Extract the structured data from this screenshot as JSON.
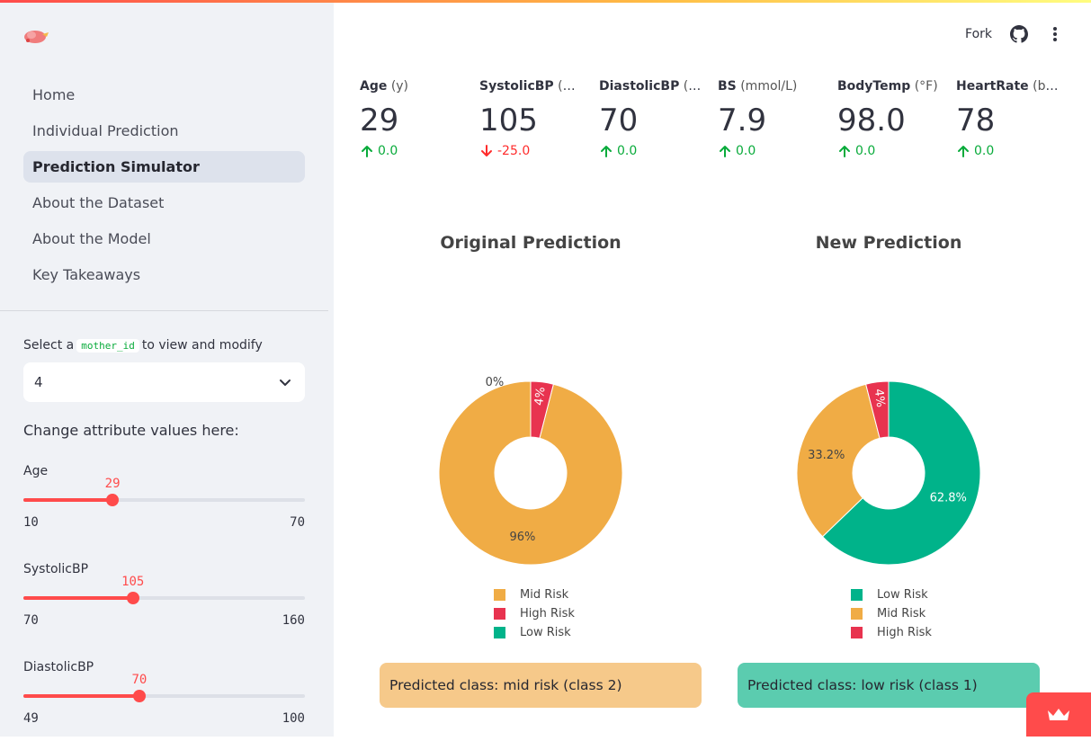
{
  "sidebar": {
    "nav": [
      {
        "label": "Home"
      },
      {
        "label": "Individual Prediction"
      },
      {
        "label": "Prediction Simulator",
        "active": true
      },
      {
        "label": "About the Dataset"
      },
      {
        "label": "About the Model"
      },
      {
        "label": "Key Takeaways"
      }
    ],
    "select": {
      "label_before": "Select a",
      "label_code": "mother_id",
      "label_after": "to view and modify",
      "value": "4"
    },
    "change_label": "Change attribute values here:",
    "sliders": [
      {
        "label": "Age",
        "value": 29,
        "min": 10,
        "max": 70
      },
      {
        "label": "SystolicBP",
        "value": 105,
        "min": 70,
        "max": 160
      },
      {
        "label": "DiastolicBP",
        "value": 70,
        "min": 49,
        "max": 100
      }
    ]
  },
  "header": {
    "fork_label": "Fork",
    "icons": [
      "github-icon",
      "kebab-menu-icon"
    ]
  },
  "metrics": [
    {
      "name": "Age",
      "unit": "(y)",
      "value": "29",
      "delta": "0.0",
      "direction": "up"
    },
    {
      "name": "SystolicBP",
      "unit": "(m…",
      "value": "105",
      "delta": "-25.0",
      "direction": "down"
    },
    {
      "name": "DiastolicBP",
      "unit": "(m…",
      "value": "70",
      "delta": "0.0",
      "direction": "up"
    },
    {
      "name": "BS",
      "unit": "(mmol/L)",
      "value": "7.9",
      "delta": "0.0",
      "direction": "up"
    },
    {
      "name": "BodyTemp",
      "unit": "(°F)",
      "value": "98.0",
      "delta": "0.0",
      "direction": "up"
    },
    {
      "name": "HeartRate",
      "unit": "(bpm)",
      "value": "78",
      "delta": "0.0",
      "direction": "up"
    }
  ],
  "colors": {
    "mid_risk": "#f0ac45",
    "high_risk": "#e8334f",
    "low_risk": "#00b38a",
    "accent": "#ff4b4b"
  },
  "chart_data": [
    {
      "type": "pie",
      "title": "Original Prediction",
      "hole": true,
      "slices": [
        {
          "label": "Mid Risk",
          "value": 96,
          "text": "96%",
          "color": "#f0ac45"
        },
        {
          "label": "High Risk",
          "value": 4,
          "text": "4%",
          "color": "#e8334f"
        },
        {
          "label": "Low Risk",
          "value": 0,
          "text": "0%",
          "color": "#00b38a"
        }
      ],
      "legend": [
        "Mid Risk",
        "High Risk",
        "Low Risk"
      ]
    },
    {
      "type": "pie",
      "title": "New Prediction",
      "hole": true,
      "slices": [
        {
          "label": "Low Risk",
          "value": 62.8,
          "text": "62.8%",
          "color": "#00b38a"
        },
        {
          "label": "Mid Risk",
          "value": 33.2,
          "text": "33.2%",
          "color": "#f0ac45"
        },
        {
          "label": "High Risk",
          "value": 4,
          "text": "4%",
          "color": "#e8334f"
        }
      ],
      "legend": [
        "Low Risk",
        "Mid Risk",
        "High Risk"
      ]
    }
  ],
  "results": {
    "original": "Predicted class: mid risk (class 2)",
    "new": "Predicted class: low risk (class 1)"
  }
}
